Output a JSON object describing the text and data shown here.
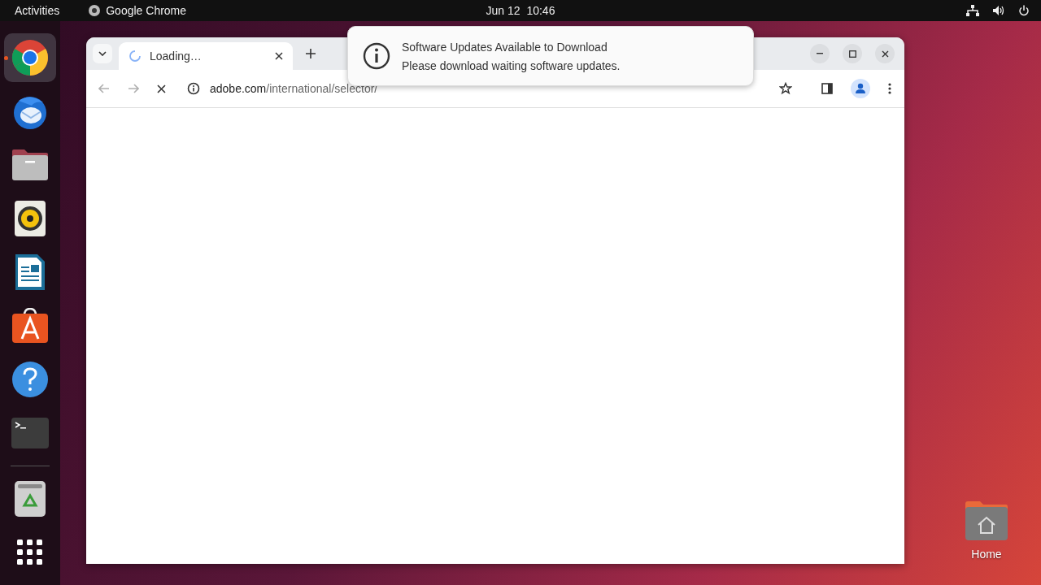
{
  "top_bar": {
    "activities": "Activities",
    "app_name": "Google Chrome",
    "clock": "Jun 12  10:46"
  },
  "dock": {
    "items": [
      {
        "kind": "chrome",
        "active": true
      },
      {
        "kind": "mail",
        "active": false
      },
      {
        "kind": "files",
        "active": false
      },
      {
        "kind": "music",
        "active": false
      },
      {
        "kind": "writer",
        "active": false
      },
      {
        "kind": "store",
        "active": false
      },
      {
        "kind": "help",
        "active": false
      },
      {
        "kind": "terminal",
        "active": false
      }
    ],
    "bottom": [
      {
        "kind": "trash",
        "active": false
      },
      {
        "kind": "apps",
        "active": false
      }
    ]
  },
  "browser": {
    "tab": {
      "title": "Loading…",
      "loading": true
    },
    "url": {
      "domain": "adobe.com",
      "path": "/international/selector/"
    }
  },
  "notification": {
    "title": "Software Updates Available to Download",
    "body": "Please download waiting software updates."
  },
  "desktop_icons": [
    {
      "label": "Home"
    }
  ]
}
